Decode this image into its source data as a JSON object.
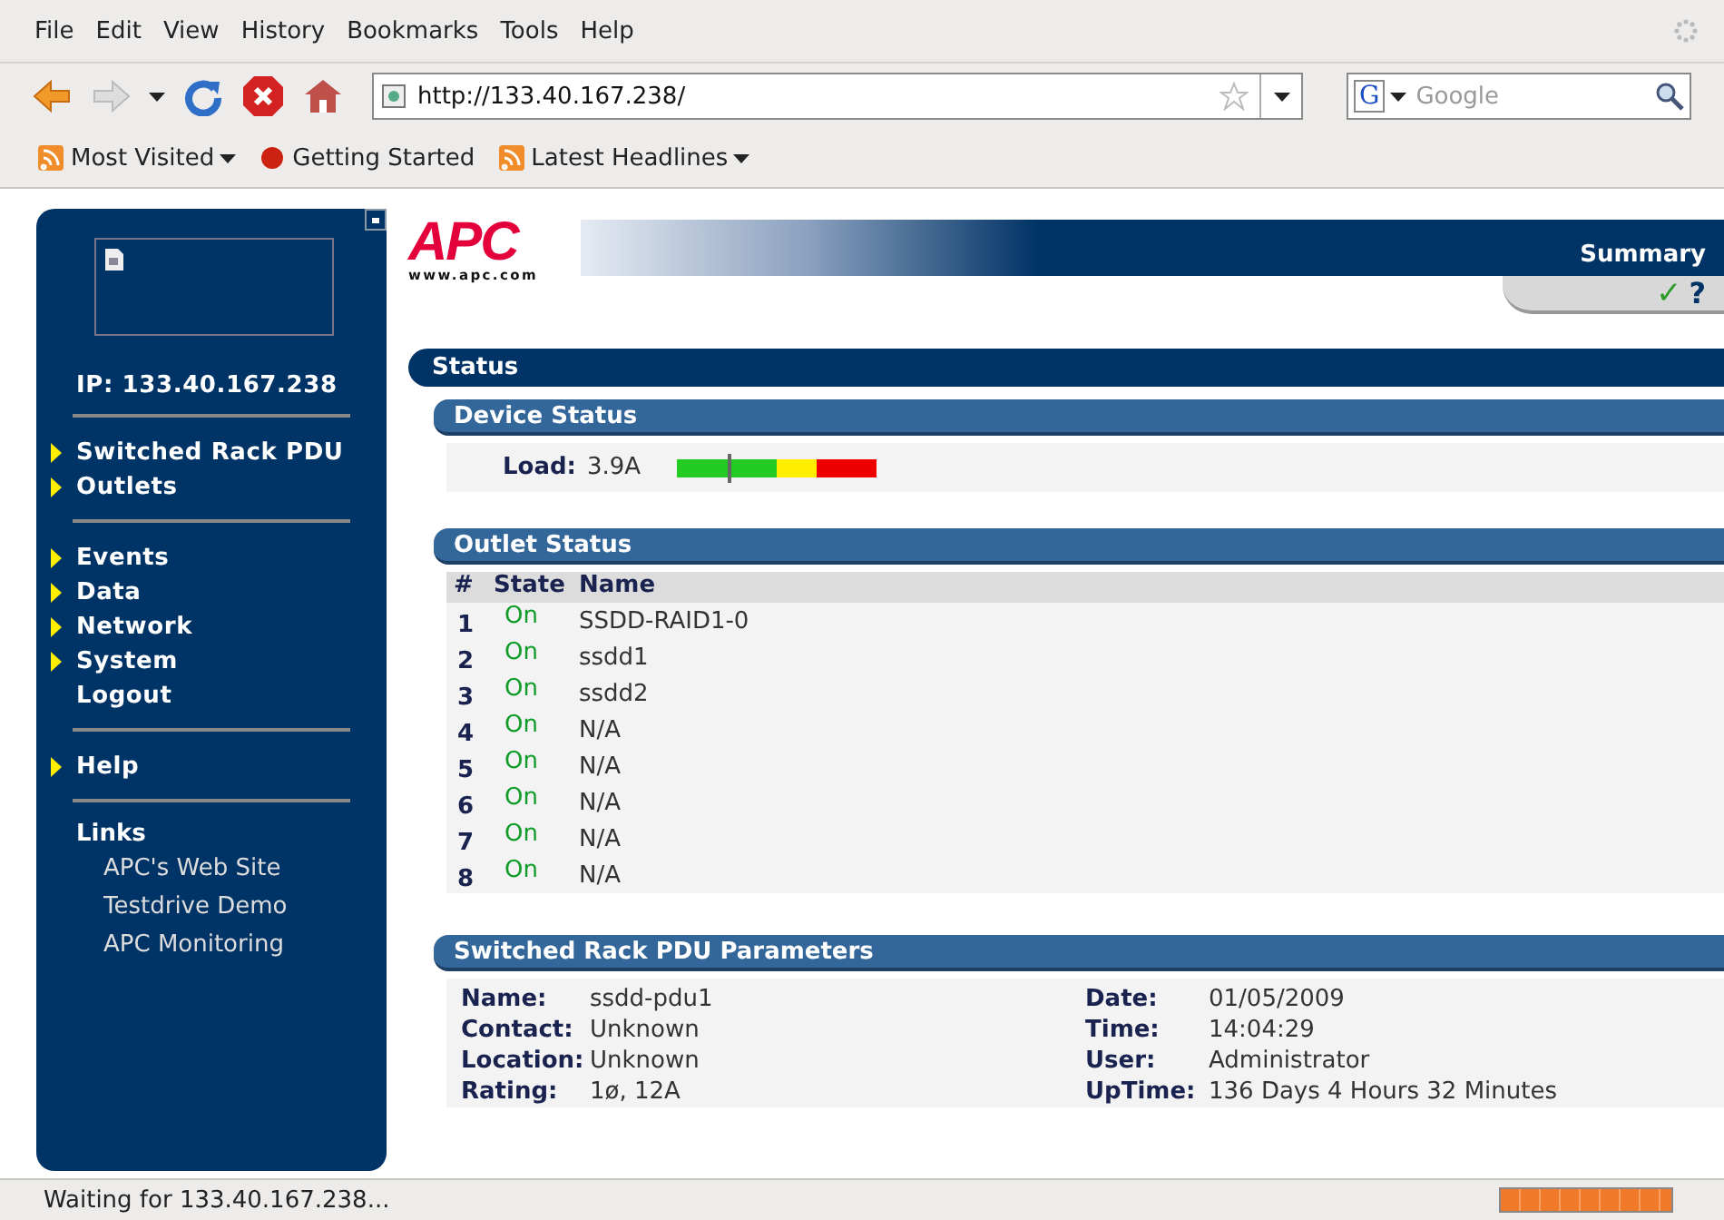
{
  "menu_bar": [
    "File",
    "Edit",
    "View",
    "History",
    "Bookmarks",
    "Tools",
    "Help"
  ],
  "address_bar": {
    "value": "http://133.40.167.238/"
  },
  "search_field": {
    "engine": "G",
    "placeholder": "Google"
  },
  "bookmarks": [
    {
      "label": "Most Visited",
      "dropdown": true
    },
    {
      "label": "Getting Started",
      "dropdown": false
    },
    {
      "label": "Latest Headlines",
      "dropdown": true
    }
  ],
  "sidebar": {
    "ip": "IP: 133.40.167.238",
    "groups": [
      [
        {
          "label": "Switched Rack PDU",
          "arrow": true
        },
        {
          "label": "Outlets",
          "arrow": true
        }
      ],
      [
        {
          "label": "Events",
          "arrow": true
        },
        {
          "label": "Data",
          "arrow": true
        },
        {
          "label": "Network",
          "arrow": true
        },
        {
          "label": "System",
          "arrow": true
        },
        {
          "label": "Logout",
          "arrow": false
        }
      ],
      [
        {
          "label": "Help",
          "arrow": true
        }
      ]
    ],
    "links_title": "Links",
    "links": [
      "APC's Web Site",
      "Testdrive Demo",
      "APC Monitoring"
    ]
  },
  "header": {
    "logo": "APC",
    "logo_url": "www.apc.com",
    "page": "Summary",
    "check": "✓",
    "help": "?"
  },
  "status_title": "Status",
  "device_status": {
    "title": "Device Status",
    "label": "Load:",
    "value": "3.9A",
    "level": 0.25
  },
  "outlet_status": {
    "title": "Outlet Status",
    "columns": [
      "#",
      "State",
      "Name"
    ],
    "rows": [
      {
        "num": "1",
        "state": "On",
        "on": true,
        "name": "SSDD-RAID1-0"
      },
      {
        "num": "2",
        "state": "On",
        "on": true,
        "name": "ssdd1"
      },
      {
        "num": "3",
        "state": "On",
        "on": true,
        "name": "ssdd2"
      },
      {
        "num": "4",
        "state": "On",
        "on": true,
        "name": "N/A"
      },
      {
        "num": "5",
        "state": "On",
        "on": true,
        "name": "N/A"
      },
      {
        "num": "6",
        "state": "On",
        "on": true,
        "name": "N/A"
      },
      {
        "num": "7",
        "state": "On",
        "on": true,
        "name": "N/A"
      },
      {
        "num": "8",
        "state": "On",
        "on": true,
        "name": "N/A"
      }
    ]
  },
  "parameters": {
    "title": "Switched Rack PDU Parameters",
    "left": [
      {
        "label": "Name:",
        "value": "ssdd-pdu1"
      },
      {
        "label": "Contact:",
        "value": "Unknown"
      },
      {
        "label": "Location:",
        "value": "Unknown"
      },
      {
        "label": "Rating:",
        "value": "1ø, 12A"
      }
    ],
    "right": [
      {
        "label": "Date:",
        "value": "01/05/2009"
      },
      {
        "label": "Time:",
        "value": "14:04:29"
      },
      {
        "label": "User:",
        "value": "Administrator"
      },
      {
        "label": "UpTime:",
        "value": "136 Days 4 Hours 32 Minutes"
      }
    ]
  },
  "status_bar": {
    "text": "Waiting for 133.40.167.238...",
    "level": 1
  }
}
